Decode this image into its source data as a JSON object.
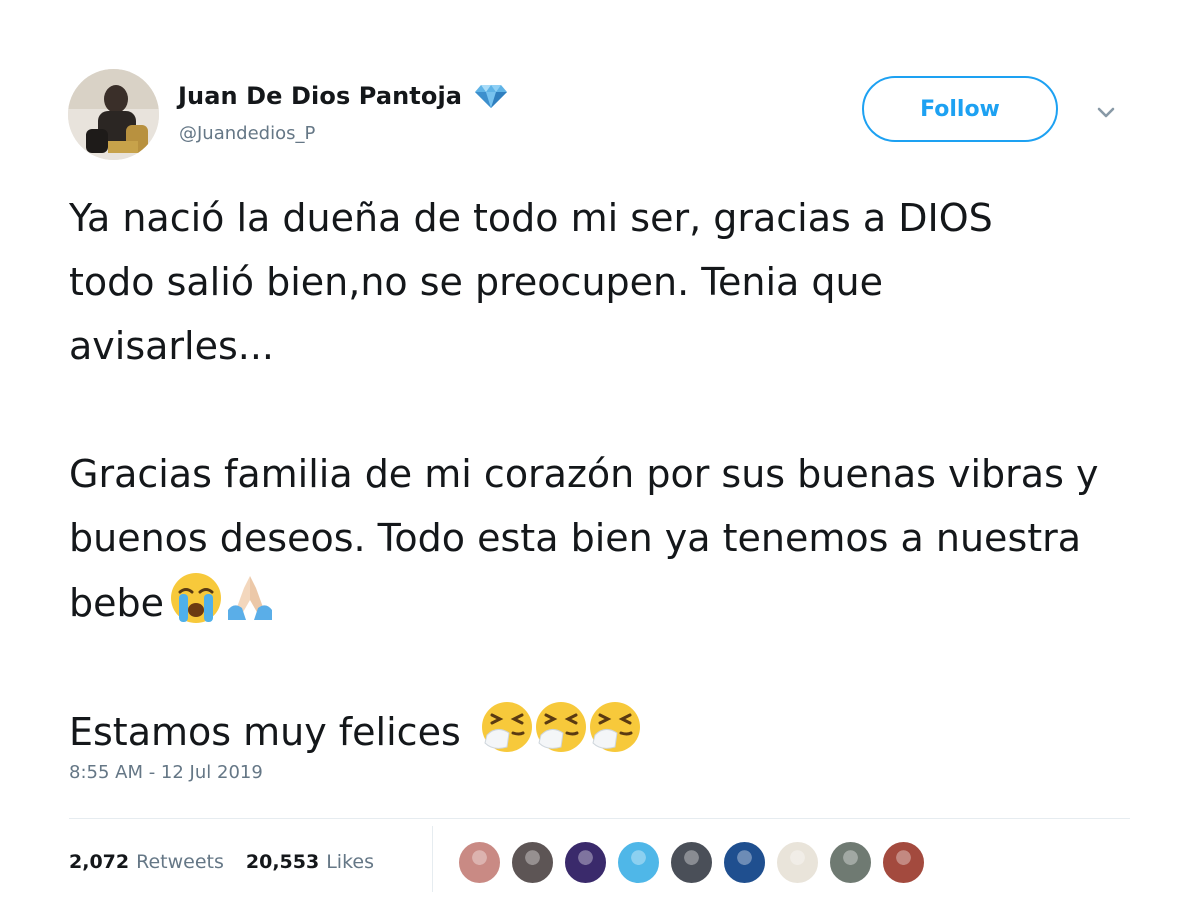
{
  "tweet": {
    "author": {
      "display_name": "Juan De Dios Pantoja",
      "handle": "@Juandedios_P",
      "verified_icon": "verified-diamond-icon"
    },
    "follow_label": "Follow",
    "text": {
      "paragraph_1": "Ya nació la dueña de todo mi ser, gracias a DIOS todo salió bien,no se preocupen. Tenia que avisarles...",
      "paragraph_2": "Gracias familia de mi corazón por sus buenas vibras y buenos deseos. Todo esta bien ya tenemos a nuestra bebe",
      "paragraph_2_emojis": [
        "loudly-crying-face",
        "folded-hands"
      ],
      "paragraph_3": "Estamos muy felices",
      "paragraph_3_emojis": [
        "sneezing-face",
        "sneezing-face",
        "sneezing-face"
      ]
    },
    "timestamp": "8:55 AM - 12 Jul 2019",
    "stats": {
      "retweets_count": "2,072",
      "retweets_label": "Retweets",
      "likes_count": "20,553",
      "likes_label": "Likes"
    },
    "liker_avatar_colors": [
      "#c98a84",
      "#5d5555",
      "#3a2a6b",
      "#4fb7e8",
      "#4a4f58",
      "#1f4f8f",
      "#e9e4da",
      "#6f7a72",
      "#a34a3e"
    ]
  },
  "colors": {
    "accent": "#1da1f2",
    "text_primary": "#14171a",
    "text_secondary": "#657786"
  }
}
